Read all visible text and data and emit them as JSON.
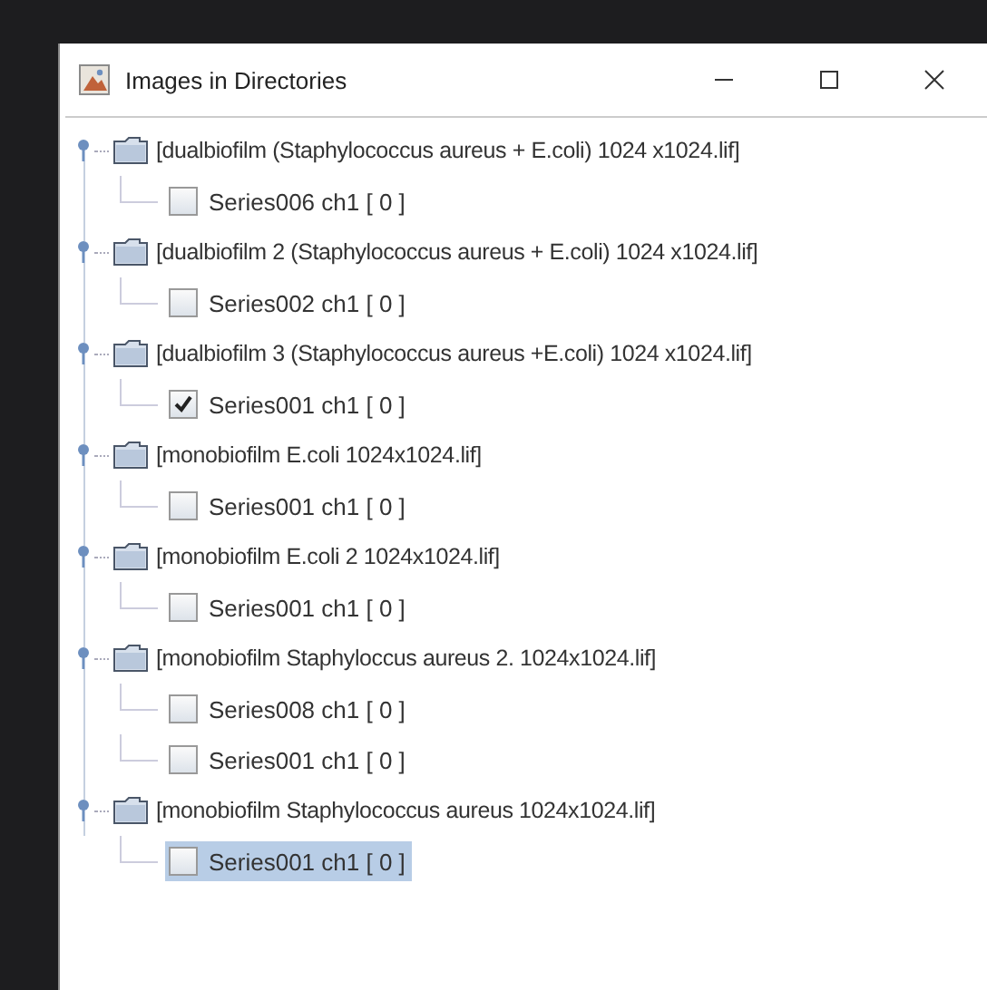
{
  "window": {
    "title": "Images in Directories"
  },
  "tree": [
    {
      "label": "[dualbiofilm (Staphylococcus aureus + E.coli) 1024 x1024.lif]",
      "expanded": true,
      "children": [
        {
          "label": "Series006 ch1 [ 0 ]",
          "checked": false,
          "selected": false
        }
      ]
    },
    {
      "label": "[dualbiofilm 2 (Staphylococcus aureus + E.coli) 1024 x1024.lif]",
      "expanded": true,
      "children": [
        {
          "label": "Series002 ch1 [ 0 ]",
          "checked": false,
          "selected": false
        }
      ]
    },
    {
      "label": "[dualbiofilm 3 (Staphylococcus aureus +E.coli)  1024 x1024.lif]",
      "expanded": true,
      "children": [
        {
          "label": "Series001 ch1 [ 0 ]",
          "checked": true,
          "selected": false
        }
      ]
    },
    {
      "label": "[monobiofilm E.coli 1024x1024.lif]",
      "expanded": true,
      "children": [
        {
          "label": "Series001 ch1 [ 0 ]",
          "checked": false,
          "selected": false
        }
      ]
    },
    {
      "label": "[monobiofilm E.coli 2 1024x1024.lif]",
      "expanded": true,
      "children": [
        {
          "label": "Series001 ch1 [ 0 ]",
          "checked": false,
          "selected": false
        }
      ]
    },
    {
      "label": "[monobiofilm Staphyloccus aureus 2. 1024x1024.lif]",
      "expanded": true,
      "children": [
        {
          "label": "Series008 ch1 [ 0 ]",
          "checked": false,
          "selected": false
        },
        {
          "label": "Series001 ch1 [ 0 ]",
          "checked": false,
          "selected": false
        }
      ]
    },
    {
      "label": "[monobiofilm Staphylococcus aureus 1024x1024.lif]",
      "expanded": true,
      "children": [
        {
          "label": "Series001 ch1 [ 0 ]",
          "checked": false,
          "selected": true
        }
      ]
    }
  ]
}
